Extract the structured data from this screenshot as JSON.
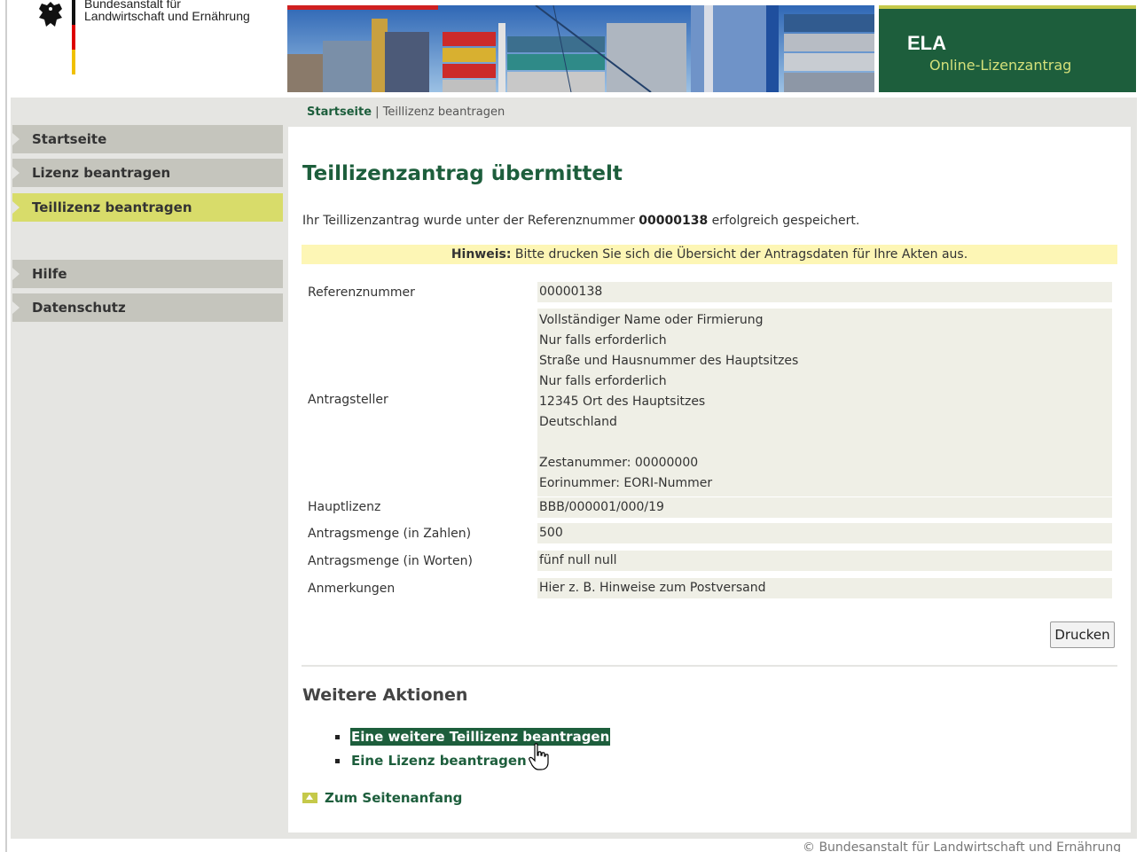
{
  "header": {
    "org_line1": "Bundesanstalt für",
    "org_line2": "Landwirtschaft und Ernährung",
    "app_title": "ELA",
    "app_subtitle": "Online-Lizenzantrag"
  },
  "breadcrumb": {
    "home": "Startseite",
    "separator": " | ",
    "current": "Teillizenz beantragen"
  },
  "sidebar": {
    "items": [
      {
        "label": "Startseite",
        "active": false
      },
      {
        "label": "Lizenz beantragen",
        "active": false
      },
      {
        "label": "Teillizenz beantragen",
        "active": true
      },
      {
        "label": "Hilfe",
        "active": false
      },
      {
        "label": "Datenschutz",
        "active": false
      }
    ]
  },
  "main": {
    "title": "Teillizenzantrag übermittelt",
    "intro_before": "Ihr Teillizenzantrag wurde unter der Referenznummer ",
    "intro_ref": "00000138",
    "intro_after": " erfolgreich gespeichert.",
    "hint_label": "Hinweis:",
    "hint_text": " Bitte drucken Sie sich die Übersicht der Antragsdaten für Ihre Akten aus.",
    "details": [
      {
        "label": "Referenznummer",
        "lines": [
          "00000138"
        ]
      },
      {
        "label": "Antragsteller",
        "lines": [
          "Vollständiger Name oder Firmierung",
          "Nur falls erforderlich",
          "Straße und Hausnummer des Hauptsitzes",
          "Nur falls erforderlich",
          "12345 Ort des Hauptsitzes",
          "Deutschland",
          "",
          "Zestanummer: 00000000",
          "Eorinummer: EORI-Nummer"
        ]
      },
      {
        "label": "Hauptlizenz",
        "lines": [
          "BBB/000001/000/19"
        ]
      },
      {
        "label": "Antragsmenge (in Zahlen)",
        "lines": [
          "500"
        ]
      },
      {
        "label": "Antragsmenge (in Worten)",
        "lines": [
          "fünf null null"
        ]
      },
      {
        "label": "Anmerkungen",
        "lines": [
          "Hier z. B. Hinweise zum Postversand"
        ]
      }
    ],
    "print_label": "Drucken",
    "more_title": "Weitere Aktionen",
    "more_links": [
      "Eine weitere Teillizenz beantragen",
      "Eine Lizenz beantragen"
    ],
    "to_top": "Zum Seitenanfang"
  },
  "footer": {
    "copyright": "© Bundesanstalt für Landwirtschaft und Ernährung"
  },
  "colors": {
    "brand_green": "#1d5e3c",
    "accent_yellow": "#d8dc6a",
    "hint_bg": "#fdf6b5",
    "nav_gray": "#c5c5bd"
  }
}
